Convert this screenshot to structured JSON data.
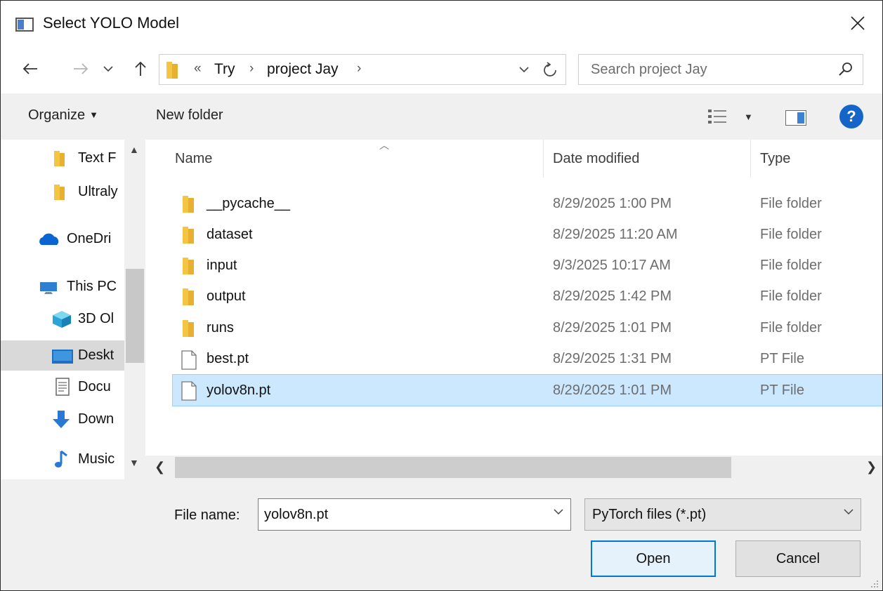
{
  "window": {
    "title": "Select YOLO Model"
  },
  "address": {
    "overflow": "«",
    "crumbs": [
      "Try",
      "project Jay"
    ],
    "separator": "›"
  },
  "search": {
    "placeholder": "Search project Jay"
  },
  "toolbar": {
    "organize_label": "Organize",
    "new_folder_label": "New folder"
  },
  "nav_pane": {
    "items": [
      {
        "label": "Text F",
        "icon": "folder-icon"
      },
      {
        "label": "Ultraly",
        "icon": "folder-icon"
      },
      {
        "label": "OneDri",
        "icon": "onedrive-cloud-icon"
      },
      {
        "label": "This PC",
        "icon": "this-pc-icon"
      },
      {
        "label": "3D Ol",
        "icon": "3d-objects-icon"
      },
      {
        "label": "Deskt",
        "icon": "desktop-icon",
        "selected": true
      },
      {
        "label": "Docu",
        "icon": "documents-icon"
      },
      {
        "label": "Down",
        "icon": "downloads-arrow-icon"
      },
      {
        "label": "Music",
        "icon": "music-note-icon"
      }
    ]
  },
  "file_list": {
    "columns": {
      "name": "Name",
      "date": "Date modified",
      "type": "Type"
    },
    "rows": [
      {
        "name": "__pycache__",
        "date": "8/29/2025 1:00 PM",
        "type": "File folder",
        "icon": "folder-icon"
      },
      {
        "name": "dataset",
        "date": "8/29/2025 11:20 AM",
        "type": "File folder",
        "icon": "folder-icon"
      },
      {
        "name": "input",
        "date": "9/3/2025 10:17 AM",
        "type": "File folder",
        "icon": "folder-icon"
      },
      {
        "name": "output",
        "date": "8/29/2025 1:42 PM",
        "type": "File folder",
        "icon": "folder-icon"
      },
      {
        "name": "runs",
        "date": "8/29/2025 1:01 PM",
        "type": "File folder",
        "icon": "folder-icon"
      },
      {
        "name": "best.pt",
        "date": "8/29/2025 1:31 PM",
        "type": "PT File",
        "icon": "file-icon"
      },
      {
        "name": "yolov8n.pt",
        "date": "8/29/2025 1:01 PM",
        "type": "PT File",
        "icon": "file-icon",
        "selected": true
      }
    ]
  },
  "footer": {
    "file_name_label": "File name:",
    "file_name_value": "yolov8n.pt",
    "file_type_value": "PyTorch files (*.pt)",
    "open_label": "Open",
    "cancel_label": "Cancel"
  },
  "colors": {
    "selection_bg": "#cce8ff",
    "selection_border": "#99d1ff",
    "folder_yellow": "#f4c542",
    "accent_blue": "#0078d7",
    "chrome_gray": "#f0f0f0"
  }
}
